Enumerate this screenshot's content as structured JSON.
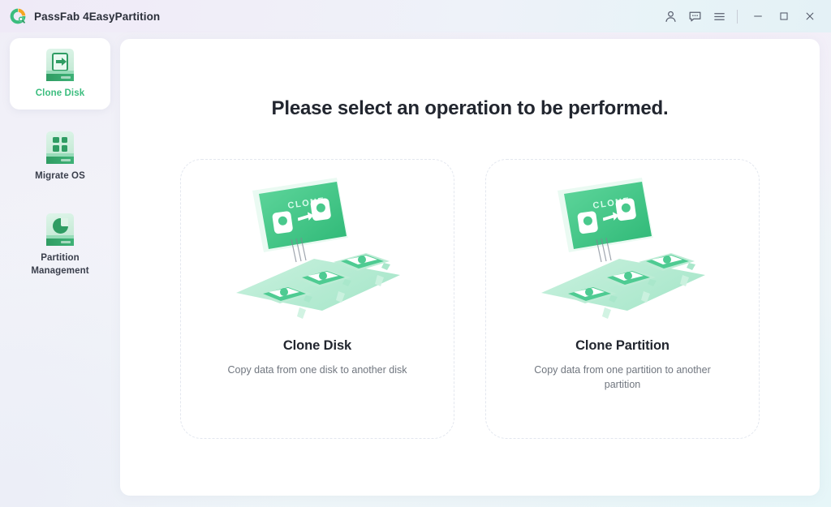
{
  "window": {
    "title": "PassFab 4EasyPartition",
    "logo_icon": "passfab-logo-icon"
  },
  "titlebar": {
    "account_icon": "user-account-icon",
    "feedback_icon": "chat-bubble-icon",
    "menu_icon": "hamburger-menu-icon",
    "minimize_icon": "minimize-icon",
    "maximize_icon": "maximize-icon",
    "close_icon": "close-icon"
  },
  "sidebar": {
    "items": [
      {
        "label": "Clone Disk",
        "icon": "clone-disk-icon",
        "active": true
      },
      {
        "label": "Migrate OS",
        "icon": "migrate-os-icon",
        "active": false
      },
      {
        "label": "Partition Management",
        "icon": "partition-management-icon",
        "active": false
      }
    ]
  },
  "main": {
    "heading": "Please select an operation to be performed.",
    "options": [
      {
        "title": "Clone Disk",
        "description": "Copy data from one disk to another disk",
        "illustration_label": "CLONE",
        "illustration_icon": "clone-disk-illustration"
      },
      {
        "title": "Clone Partition",
        "description": "Copy data from one partition to another partition",
        "illustration_label": "CLONE",
        "illustration_icon": "clone-partition-illustration"
      }
    ]
  },
  "colors": {
    "accent_green": "#3bbd7e",
    "deep_green": "#2f9c63",
    "text_dark": "#22262f",
    "text_muted": "#70767f"
  }
}
